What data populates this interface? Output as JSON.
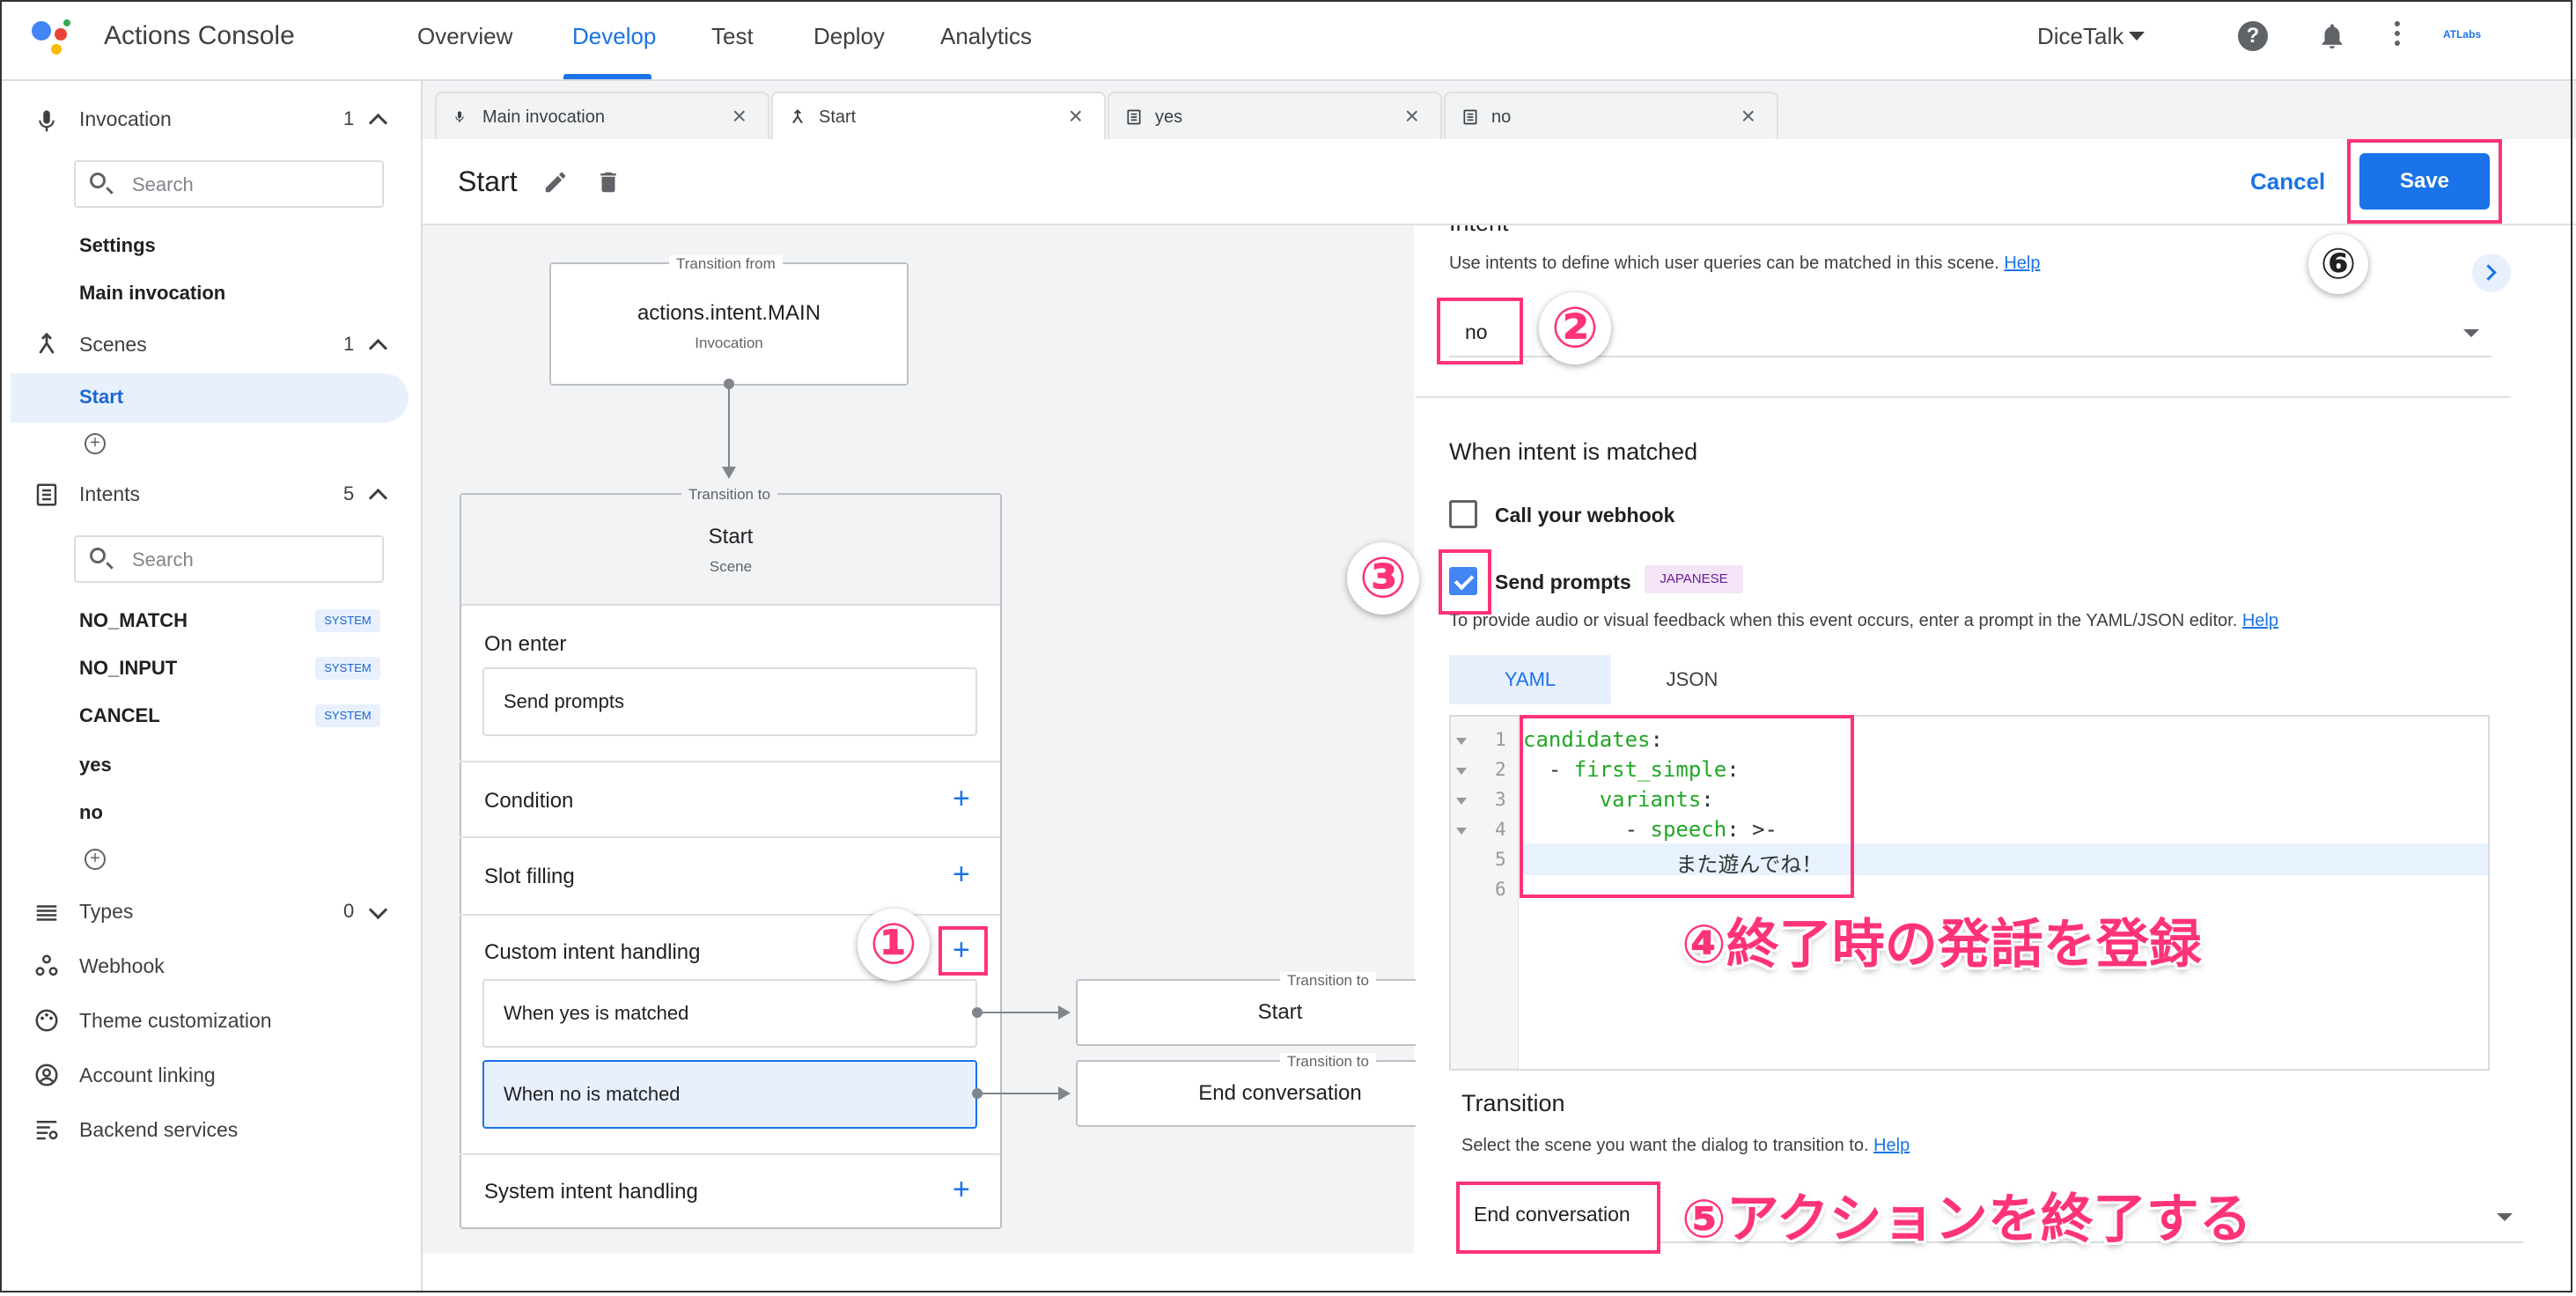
{
  "app": {
    "title": "Actions Console",
    "project": "DiceTalk",
    "brand": "ATLabs"
  },
  "nav": [
    "Overview",
    "Develop",
    "Test",
    "Deploy",
    "Analytics"
  ],
  "sidebar": {
    "invocation": {
      "label": "Invocation",
      "count": "1",
      "search_placeholder": "Search",
      "items": [
        "Settings",
        "Main invocation"
      ]
    },
    "scenes": {
      "label": "Scenes",
      "count": "1",
      "items": [
        "Start"
      ]
    },
    "intents": {
      "label": "Intents",
      "count": "5",
      "search_placeholder": "Search",
      "items": [
        {
          "label": "NO_MATCH",
          "badge": "SYSTEM"
        },
        {
          "label": "NO_INPUT",
          "badge": "SYSTEM"
        },
        {
          "label": "CANCEL",
          "badge": "SYSTEM"
        },
        {
          "label": "yes",
          "badge": ""
        },
        {
          "label": "no",
          "badge": ""
        }
      ]
    },
    "types": {
      "label": "Types",
      "count": "0"
    },
    "links": [
      "Webhook",
      "Theme customization",
      "Account linking",
      "Backend services"
    ]
  },
  "tabs": [
    "Main invocation",
    "Start",
    "yes",
    "no"
  ],
  "editor": {
    "title": "Start",
    "cancel": "Cancel",
    "save": "Save"
  },
  "canvas": {
    "from": {
      "label": "Transition from",
      "main": "actions.intent.MAIN",
      "sub": "Invocation"
    },
    "scene": {
      "label": "Transition to",
      "main": "Start",
      "sub": "Scene"
    },
    "on_enter": {
      "title": "On enter",
      "box": "Send prompts"
    },
    "condition": "Condition",
    "slot_filling": "Slot filling",
    "custom": {
      "title": "Custom intent handling",
      "items": [
        "When yes is matched",
        "When no is matched"
      ]
    },
    "system": "System intent handling",
    "targets": [
      {
        "label": "Transition to",
        "main": "Start"
      },
      {
        "label": "Transition to",
        "main": "End conversation"
      }
    ]
  },
  "panel": {
    "intent_heading": "Intent",
    "intent_help": "Use intents to define which user queries can be matched in this scene.",
    "help": "Help",
    "intent_value": "no",
    "matched_heading": "When intent is matched",
    "webhook_label": "Call your webhook",
    "prompts_label": "Send prompts",
    "language_badge": "JAPANESE",
    "prompts_help": "To provide audio or visual feedback when this event occurs, enter a prompt in the YAML/JSON editor.",
    "format_tabs": [
      "YAML",
      "JSON"
    ],
    "code_lines": [
      {
        "n": "1",
        "indent": "",
        "key": "candidates",
        "rest": ":"
      },
      {
        "n": "2",
        "indent": "  - ",
        "key": "first_simple",
        "rest": ":"
      },
      {
        "n": "3",
        "indent": "      ",
        "key": "variants",
        "rest": ":"
      },
      {
        "n": "4",
        "indent": "        - ",
        "key": "speech",
        "rest": ": >-"
      },
      {
        "n": "5",
        "indent": "            ",
        "key": "",
        "rest": "また遊んでね！"
      },
      {
        "n": "6",
        "indent": "",
        "key": "",
        "rest": ""
      }
    ],
    "transition_heading": "Transition",
    "transition_help": "Select the scene you want the dialog to transition to.",
    "transition_value": "End conversation"
  },
  "annotations": {
    "n1": "①",
    "n2": "②",
    "n3": "③",
    "n6": "⑥",
    "t4": "④終了時の発話を登録",
    "t5": "⑤アクションを終了する"
  },
  "colors": {
    "accent": "#1a73e8",
    "annotation": "#ff3377",
    "selected_bg": "#e8f0fe"
  }
}
